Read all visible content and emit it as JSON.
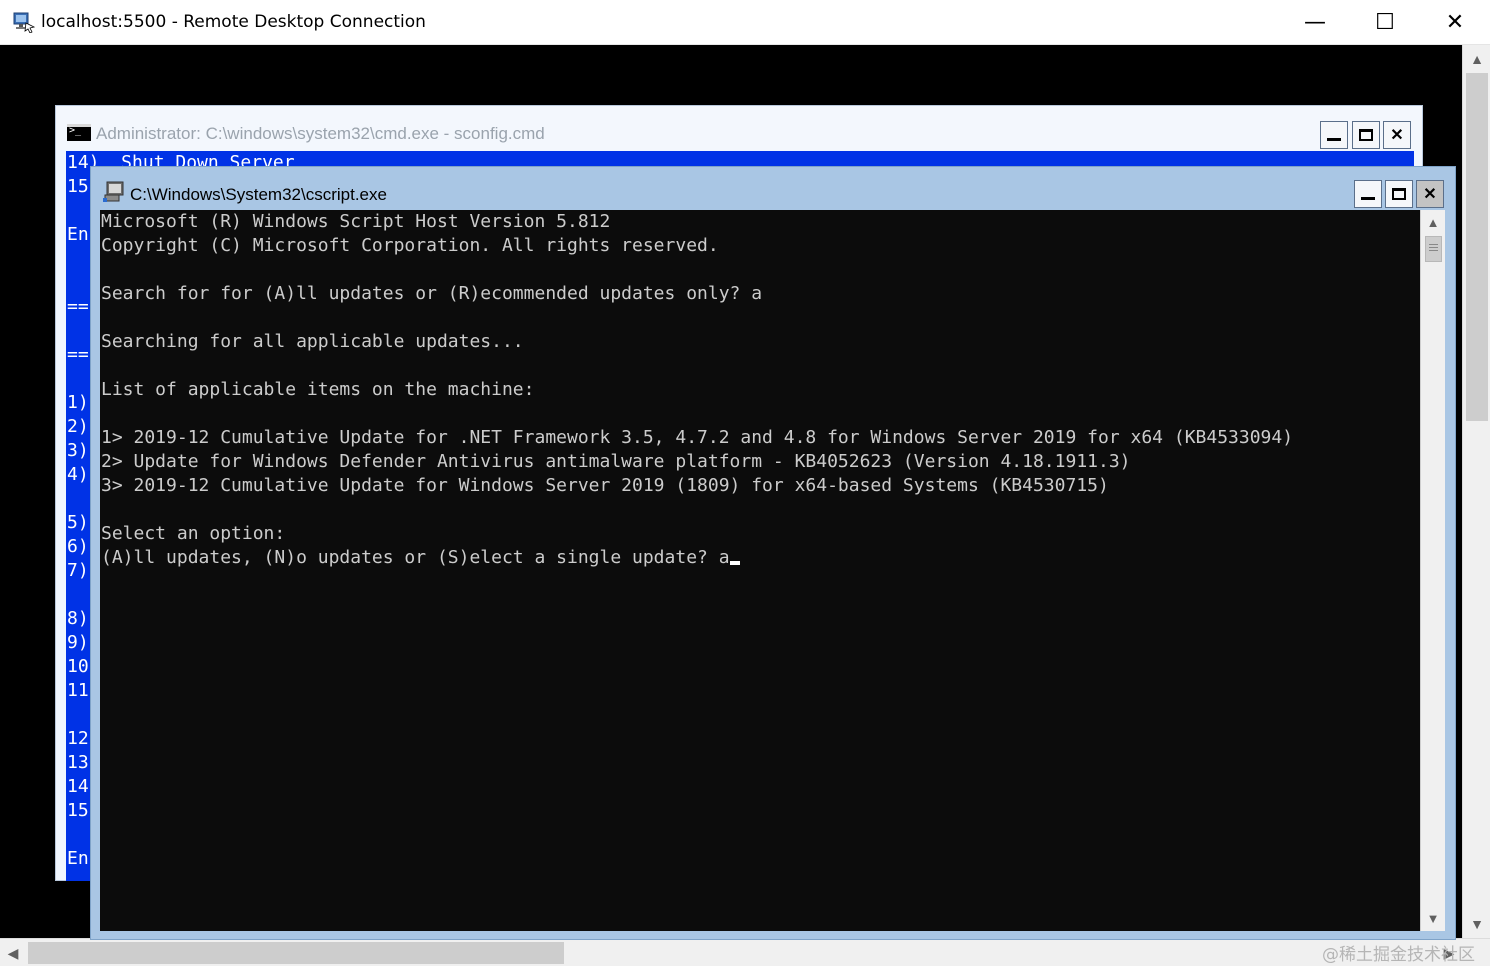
{
  "rdp": {
    "title": "localhost:5500 - Remote Desktop Connection",
    "controls": {
      "minimize": "—",
      "maximize": "☐",
      "close": "✕"
    }
  },
  "cmd_window": {
    "title": "Administrator: C:\\windows\\system32\\cmd.exe - sconfig.cmd",
    "console_lines": [
      {
        "text": "14)  Shut Down Server",
        "row": 0
      },
      {
        "text": "15",
        "row": 1
      },
      {
        "text": "En",
        "row": 3
      },
      {
        "text": "==",
        "row": 6
      },
      {
        "text": "==",
        "row": 8
      },
      {
        "text": "1)",
        "row": 10
      },
      {
        "text": "2)",
        "row": 11
      },
      {
        "text": "3)",
        "row": 12
      },
      {
        "text": "4)",
        "row": 13
      },
      {
        "text": "5)",
        "row": 15
      },
      {
        "text": "6)",
        "row": 16
      },
      {
        "text": "7)",
        "row": 17
      },
      {
        "text": "8)",
        "row": 19
      },
      {
        "text": "9)",
        "row": 20
      },
      {
        "text": "10",
        "row": 21
      },
      {
        "text": "11",
        "row": 22
      },
      {
        "text": "12",
        "row": 24
      },
      {
        "text": "13",
        "row": 25
      },
      {
        "text": "14",
        "row": 26
      },
      {
        "text": "15",
        "row": 27
      },
      {
        "text": "En",
        "row": 29
      }
    ]
  },
  "cscript_window": {
    "title": "C:\\Windows\\System32\\cscript.exe",
    "console_lines": [
      {
        "text": "Microsoft (R) Windows Script Host Version 5.812",
        "row": 0
      },
      {
        "text": "Copyright (C) Microsoft Corporation. All rights reserved.",
        "row": 1
      },
      {
        "text": "Search for for (A)ll updates or (R)ecommended updates only? a",
        "row": 3
      },
      {
        "text": "Searching for all applicable updates...",
        "row": 5
      },
      {
        "text": "List of applicable items on the machine:",
        "row": 7
      },
      {
        "text": "1> 2019-12 Cumulative Update for .NET Framework 3.5, 4.7.2 and 4.8 for Windows Server 2019 for x64 (KB4533094)",
        "row": 9
      },
      {
        "text": "2> Update for Windows Defender Antivirus antimalware platform - KB4052623 (Version 4.18.1911.3)",
        "row": 10
      },
      {
        "text": "3> 2019-12 Cumulative Update for Windows Server 2019 (1809) for x64-based Systems (KB4530715)",
        "row": 11
      },
      {
        "text": "Select an option:",
        "row": 13
      }
    ],
    "prompt_line": {
      "text": "(A)ll updates, (N)o updates or (S)elect a single update? a",
      "row": 14
    }
  },
  "watermark": "@稀土掘金技术社区",
  "colors": {
    "cmd_console_bg": "#0032e6",
    "cscript_console_bg": "#0c0c0c",
    "cscript_frame": "#a9c6e4",
    "console_text": "#cccccc"
  },
  "icons": {
    "rdp": "remote-desktop-icon",
    "cmd": "console-icon",
    "cscript": "script-host-icon"
  }
}
